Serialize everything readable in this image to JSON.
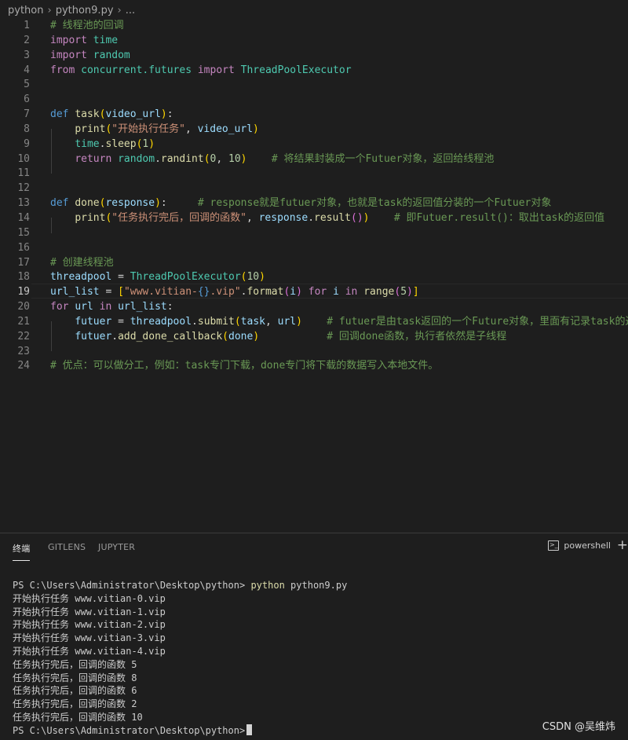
{
  "breadcrumb": {
    "folder": "python",
    "file": "python9.py",
    "more": "..."
  },
  "editor": {
    "active_line": "19",
    "lines": [
      {
        "n": "1"
      },
      {
        "n": "2"
      },
      {
        "n": "3"
      },
      {
        "n": "4"
      },
      {
        "n": "5"
      },
      {
        "n": "6"
      },
      {
        "n": "7"
      },
      {
        "n": "8"
      },
      {
        "n": "9"
      },
      {
        "n": "10"
      },
      {
        "n": "11"
      },
      {
        "n": "12"
      },
      {
        "n": "13"
      },
      {
        "n": "14"
      },
      {
        "n": "15"
      },
      {
        "n": "16"
      },
      {
        "n": "17"
      },
      {
        "n": "18"
      },
      {
        "n": "19"
      },
      {
        "n": "20"
      },
      {
        "n": "21"
      },
      {
        "n": "22"
      },
      {
        "n": "23"
      },
      {
        "n": "24"
      }
    ],
    "comment_title": "# 线程池的回调",
    "comment_10": "# 将结果封装成一个Futuer对象，返回给线程池",
    "comment_13": "# response就是futuer对象，也就是task的返回值分装的一个Futuer对象",
    "str_14": "\"任务执行完后，回调的函数\"",
    "comment_14": "# 即Futuer.result()：取出task的返回值",
    "str_8": "\"开始执行任务\"",
    "comment_17": "# 创建线程池",
    "str_19a": "\"www.vitian-",
    "str_19b": "{}",
    "str_19c": ".vip\"",
    "comment_21": "# futuer是由task返回的一个Future对象，里面有记录task的返",
    "comment_22": "# 回调done函数，执行者依然是子线程",
    "comment_24": "# 优点：可以做分工，例如：task专门下载，done专门将下载的数据写入本地文件。"
  },
  "panel": {
    "tabs": [
      "终端",
      "GITLENS",
      "JUPYTER"
    ],
    "active_tab": "终端",
    "shell_label": "powershell",
    "add_icon": "plus-icon"
  },
  "terminal": {
    "prompt": "PS C:\\Users\\Administrator\\Desktop\\python>",
    "command_name": "python",
    "command_arg": "python9.py",
    "output": [
      "开始执行任务 www.vitian-0.vip",
      "开始执行任务 www.vitian-1.vip",
      "开始执行任务 www.vitian-2.vip",
      "开始执行任务 www.vitian-3.vip",
      "开始执行任务 www.vitian-4.vip",
      "任务执行完后，回调的函数 5",
      "任务执行完后，回调的函数 8",
      "任务执行完后，回调的函数 6",
      "任务执行完后，回调的函数 2",
      "任务执行完后，回调的函数 10"
    ],
    "final_prompt": "PS C:\\Users\\Administrator\\Desktop\\python>"
  },
  "watermark": "CSDN @吴维炜"
}
